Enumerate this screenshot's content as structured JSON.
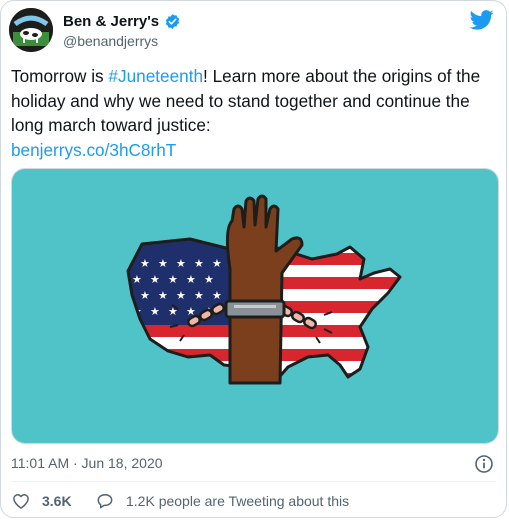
{
  "author": {
    "display_name": "Ben & Jerry's",
    "handle": "@benandjerrys",
    "verified": true,
    "avatar_icon": "ben-and-jerrys-logo-avatar"
  },
  "tweet": {
    "text_before": "Tomorrow is ",
    "hashtag": "#Juneteenth",
    "text_after": "! Learn more about the origins of the holiday and why we need to stand together and continue the long march toward justice:",
    "link": "benjerrys.co/3hC8rhT",
    "media_description_icon": "raised-fist-broken-chain-us-flag-map-illustration"
  },
  "meta": {
    "timestamp": "11:01 AM · Jun 18, 2020"
  },
  "actions": {
    "like_count": "3.6K",
    "reply_text": "1.2K people are Tweeting about this"
  },
  "colors": {
    "accent": "#1d9bf0",
    "media_background": "#4fc3c8",
    "flag_red": "#d8262f",
    "flag_blue": "#1f2f6b"
  }
}
